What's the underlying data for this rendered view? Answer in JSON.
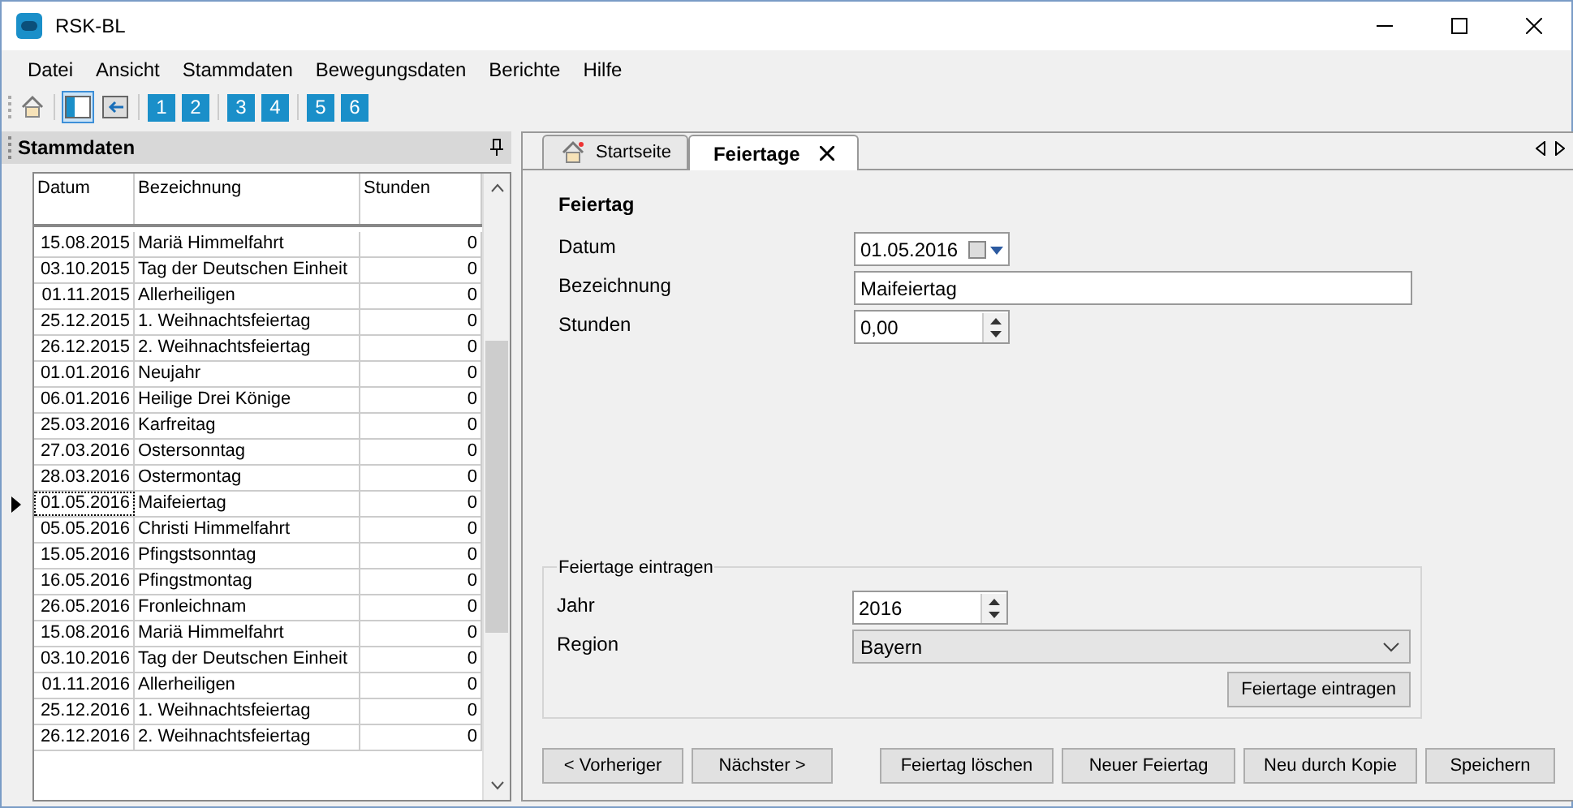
{
  "window": {
    "title": "RSK-BL"
  },
  "menu": [
    "Datei",
    "Ansicht",
    "Stammdaten",
    "Bewegungsdaten",
    "Berichte",
    "Hilfe"
  ],
  "toolbar": {
    "numbers": [
      "1",
      "2",
      "3",
      "4",
      "5",
      "6"
    ]
  },
  "panel": {
    "title": "Stammdaten",
    "columns": [
      "Datum",
      "Bezeichnung",
      "Stunden"
    ],
    "rows": [
      {
        "date": "15.08.2015",
        "name": "Mariä Himmelfahrt",
        "hours": "0",
        "selected": false
      },
      {
        "date": "03.10.2015",
        "name": "Tag der Deutschen Einheit",
        "hours": "0",
        "selected": false
      },
      {
        "date": "01.11.2015",
        "name": "Allerheiligen",
        "hours": "0",
        "selected": false
      },
      {
        "date": "25.12.2015",
        "name": "1. Weihnachtsfeiertag",
        "hours": "0",
        "selected": false
      },
      {
        "date": "26.12.2015",
        "name": "2. Weihnachtsfeiertag",
        "hours": "0",
        "selected": false
      },
      {
        "date": "01.01.2016",
        "name": "Neujahr",
        "hours": "0",
        "selected": false
      },
      {
        "date": "06.01.2016",
        "name": "Heilige Drei Könige",
        "hours": "0",
        "selected": false
      },
      {
        "date": "25.03.2016",
        "name": "Karfreitag",
        "hours": "0",
        "selected": false
      },
      {
        "date": "27.03.2016",
        "name": "Ostersonntag",
        "hours": "0",
        "selected": false
      },
      {
        "date": "28.03.2016",
        "name": "Ostermontag",
        "hours": "0",
        "selected": false
      },
      {
        "date": "01.05.2016",
        "name": "Maifeiertag",
        "hours": "0",
        "selected": true
      },
      {
        "date": "05.05.2016",
        "name": "Christi Himmelfahrt",
        "hours": "0",
        "selected": false
      },
      {
        "date": "15.05.2016",
        "name": "Pfingstsonntag",
        "hours": "0",
        "selected": false
      },
      {
        "date": "16.05.2016",
        "name": "Pfingstmontag",
        "hours": "0",
        "selected": false
      },
      {
        "date": "26.05.2016",
        "name": "Fronleichnam",
        "hours": "0",
        "selected": false
      },
      {
        "date": "15.08.2016",
        "name": "Mariä Himmelfahrt",
        "hours": "0",
        "selected": false
      },
      {
        "date": "03.10.2016",
        "name": "Tag der Deutschen Einheit",
        "hours": "0",
        "selected": false
      },
      {
        "date": "01.11.2016",
        "name": "Allerheiligen",
        "hours": "0",
        "selected": false
      },
      {
        "date": "25.12.2016",
        "name": "1. Weihnachtsfeiertag",
        "hours": "0",
        "selected": false
      },
      {
        "date": "26.12.2016",
        "name": "2. Weihnachtsfeiertag",
        "hours": "0",
        "selected": false
      }
    ]
  },
  "tabs": [
    {
      "label": "Startseite",
      "selected": false
    },
    {
      "label": "Feiertage",
      "selected": true
    }
  ],
  "form": {
    "heading": "Feiertag",
    "fields": [
      {
        "kind": "date",
        "label": "Datum",
        "value": "01.05.2016"
      },
      {
        "kind": "text",
        "label": "Bezeichnung",
        "value": "Maifeiertag"
      },
      {
        "kind": "spin",
        "label": "Stunden",
        "value": "0,00"
      }
    ]
  },
  "group": {
    "title": "Feiertage eintragen",
    "fields": [
      {
        "kind": "spin",
        "label": "Jahr",
        "value": "2016"
      },
      {
        "kind": "combo",
        "label": "Region",
        "value": "Bayern"
      }
    ],
    "button": "Feiertage eintragen"
  },
  "buttons": [
    "< Vorheriger",
    "Nächster >",
    "Feiertag löschen",
    "Neuer Feiertag",
    "Neu durch Kopie",
    "Speichern"
  ]
}
